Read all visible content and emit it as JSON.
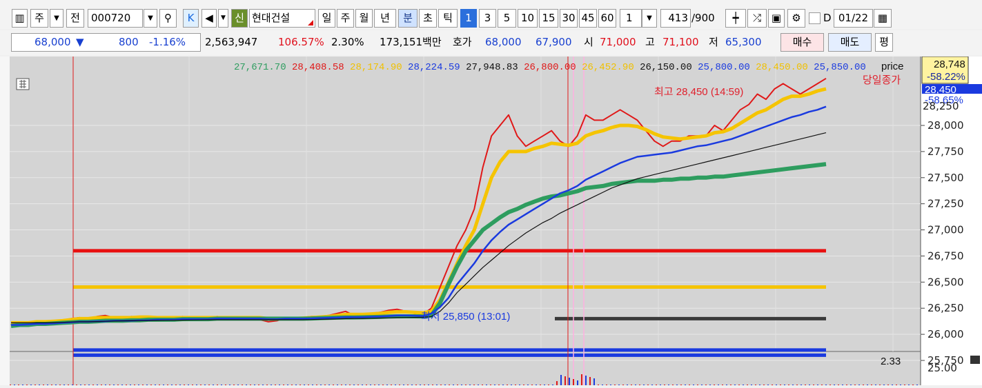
{
  "toolbar": {
    "market_btn": "주",
    "prev_btn": "전",
    "code": "000720",
    "k_btn": "K",
    "credit_badge": "신",
    "name": "현대건설",
    "periods": [
      "일",
      "주",
      "월",
      "년",
      "분",
      "초",
      "틱"
    ],
    "selected_period": "분",
    "minutes": [
      "1",
      "3",
      "5",
      "10",
      "15",
      "30",
      "45",
      "60"
    ],
    "selected_minute": "1",
    "multiplier": "1",
    "count": "413",
    "count_total": "/900",
    "date_label": "D",
    "date_value": "01/22"
  },
  "quote": {
    "price": "68,000",
    "change_arrow": "▼",
    "change": "800",
    "change_pct": "-1.16%",
    "volume": "2,563,947",
    "vol_ratio": "106.57%",
    "turnover": "2.30%",
    "amount": "173,151백만",
    "hoga_label": "호가",
    "ask": "68,000",
    "bid": "67,900",
    "open_label": "시",
    "open": "71,000",
    "high_label": "고",
    "high": "71,100",
    "low_label": "저",
    "low": "65,300",
    "buy_btn": "매수",
    "sell_btn": "매도",
    "eval_btn": "평"
  },
  "chart_data": {
    "type": "line",
    "legend_values": [
      {
        "text": "27,671.70",
        "color": "#2e9d5f"
      },
      {
        "text": "28,408.58",
        "color": "#e01818"
      },
      {
        "text": "28,174.90",
        "color": "#f0c000"
      },
      {
        "text": "28,224.59",
        "color": "#1a3adf"
      },
      {
        "text": "27,948.83",
        "color": "#111111"
      },
      {
        "text": "26,800.00",
        "color": "#e01818"
      },
      {
        "text": "26,452.90",
        "color": "#f0c000"
      },
      {
        "text": "26,150.00",
        "color": "#111111"
      },
      {
        "text": "25,800.00",
        "color": "#1a3adf"
      },
      {
        "text": "28,450.00",
        "color": "#f0c000"
      },
      {
        "text": "25,850.00",
        "color": "#1a3adf"
      }
    ],
    "legend_price": "price",
    "ylim": [
      25600,
      28850
    ],
    "yticks": [
      28000,
      27750,
      27500,
      27250,
      27000,
      26750,
      26500,
      26250,
      26000,
      25750
    ],
    "ytick_labels": [
      "28,000",
      "27,750",
      "27,500",
      "27,250",
      "27,000",
      "26,750",
      "26,500",
      "26,250",
      "26,000",
      "25,750"
    ],
    "partial_tick_label": "28,250",
    "price_box": {
      "value": "28,748",
      "pct": "-58.22%"
    },
    "last_box": {
      "value": "28,450",
      "pct": "-58.65%"
    },
    "prev_close_label": "당일종가",
    "high_annotation": "최고 28,450 (14:59)",
    "low_annotation": "최저 25,850 (13:01)",
    "levels": [
      {
        "value": 26800,
        "color": "#e81010"
      },
      {
        "value": 26452.9,
        "color": "#f5c400"
      },
      {
        "value": 26150,
        "color": "#3a3a3a"
      },
      {
        "value": 25850,
        "color": "#1a3adf"
      },
      {
        "value": 25800,
        "color": "#1a3adf"
      },
      {
        "value": 28749,
        "color": "#e0202c"
      }
    ],
    "lower_pane": {
      "indicator_value": "2.33",
      "axis_label": "25.00"
    },
    "series": [
      {
        "color": "#e01818",
        "values": [
          26090,
          26100,
          26090,
          26120,
          26100,
          26110,
          26130,
          26150,
          26160,
          26140,
          26170,
          26180,
          26160,
          26150,
          26170,
          26160,
          26170,
          26150,
          26150,
          26140,
          26170,
          26150,
          26150,
          26140,
          26170,
          26160,
          26160,
          26160,
          26150,
          26140,
          26120,
          26130,
          26160,
          26150,
          26160,
          26170,
          26170,
          26180,
          26200,
          26220,
          26180,
          26180,
          26200,
          26210,
          26230,
          26240,
          26220,
          26200,
          26190,
          26250,
          26450,
          26650,
          26850,
          27000,
          27200,
          27600,
          27900,
          28000,
          28100,
          27900,
          27800,
          27850,
          27900,
          27950,
          27850,
          27800,
          27900,
          28100,
          28050,
          28050,
          28100,
          28150,
          28100,
          28050,
          27950,
          27850,
          27800,
          27850,
          27850,
          27900,
          27900,
          27900,
          28000,
          27950,
          28050,
          28150,
          28200,
          28300,
          28250,
          28350,
          28400,
          28350,
          28300,
          28350,
          28400,
          28450
        ]
      },
      {
        "color": "#f5c400",
        "values": [
          26110,
          26110,
          26110,
          26120,
          26120,
          26125,
          26130,
          26140,
          26150,
          26150,
          26160,
          26160,
          26160,
          26160,
          26160,
          26165,
          26165,
          26160,
          26160,
          26160,
          26160,
          26160,
          26160,
          26160,
          26160,
          26160,
          26160,
          26160,
          26160,
          26160,
          26150,
          26150,
          26150,
          26150,
          26155,
          26160,
          26165,
          26170,
          26180,
          26190,
          26190,
          26190,
          26195,
          26200,
          26210,
          26215,
          26215,
          26210,
          26205,
          26220,
          26330,
          26500,
          26680,
          26850,
          27000,
          27250,
          27500,
          27650,
          27750,
          27750,
          27750,
          27780,
          27800,
          27830,
          27820,
          27810,
          27830,
          27900,
          27930,
          27950,
          27980,
          28000,
          28000,
          27990,
          27960,
          27920,
          27890,
          27880,
          27870,
          27880,
          27890,
          27900,
          27930,
          27940,
          27970,
          28020,
          28070,
          28120,
          28150,
          28200,
          28250,
          28280,
          28280,
          28300,
          28330,
          28350
        ]
      },
      {
        "color": "#2e9d5f",
        "values": [
          26080,
          26090,
          26090,
          26100,
          26100,
          26105,
          26110,
          26115,
          26120,
          26120,
          26125,
          26130,
          26130,
          26130,
          26135,
          26135,
          26140,
          26140,
          26140,
          26140,
          26145,
          26145,
          26145,
          26145,
          26150,
          26150,
          26150,
          26150,
          26150,
          26150,
          26150,
          26150,
          26150,
          26150,
          26150,
          26152,
          26155,
          26157,
          26160,
          26162,
          26162,
          26163,
          26165,
          26167,
          26170,
          26172,
          26172,
          26172,
          26171,
          26180,
          26300,
          26480,
          26650,
          26800,
          26900,
          27000,
          27060,
          27120,
          27170,
          27200,
          27240,
          27270,
          27300,
          27320,
          27330,
          27350,
          27370,
          27400,
          27410,
          27420,
          27440,
          27450,
          27460,
          27470,
          27470,
          27470,
          27480,
          27480,
          27490,
          27490,
          27500,
          27500,
          27510,
          27510,
          27520,
          27530,
          27540,
          27550,
          27560,
          27570,
          27580,
          27590,
          27600,
          27610,
          27620,
          27630
        ]
      },
      {
        "color": "#1a3adf",
        "values": [
          26090,
          26090,
          26095,
          26100,
          26100,
          26105,
          26110,
          26115,
          26120,
          26120,
          26125,
          26125,
          26130,
          26130,
          26130,
          26135,
          26135,
          26140,
          26140,
          26140,
          26145,
          26145,
          26145,
          26145,
          26150,
          26150,
          26150,
          26150,
          26150,
          26150,
          26145,
          26145,
          26150,
          26150,
          26150,
          26152,
          26155,
          26157,
          26160,
          26165,
          26165,
          26165,
          26168,
          26170,
          26175,
          26180,
          26180,
          26178,
          26175,
          26200,
          26260,
          26350,
          26480,
          26580,
          26680,
          26800,
          26900,
          26980,
          27050,
          27100,
          27150,
          27200,
          27250,
          27300,
          27350,
          27380,
          27420,
          27480,
          27520,
          27560,
          27600,
          27640,
          27670,
          27700,
          27710,
          27720,
          27730,
          27740,
          27760,
          27780,
          27800,
          27810,
          27830,
          27850,
          27870,
          27900,
          27930,
          27960,
          27990,
          28020,
          28050,
          28080,
          28100,
          28130,
          28150,
          28180
        ]
      },
      {
        "color": "#111111",
        "values": [
          26110,
          26110,
          26110,
          26110,
          26110,
          26112,
          26115,
          26118,
          26120,
          26120,
          26122,
          26125,
          26127,
          26129,
          26130,
          26131,
          26132,
          26133,
          26134,
          26135,
          26136,
          26137,
          26138,
          26139,
          26140,
          26140,
          26140,
          26140,
          26140,
          26140,
          26140,
          26140,
          26140,
          26140,
          26140,
          26141,
          26143,
          26145,
          26147,
          26150,
          26151,
          26152,
          26154,
          26156,
          26158,
          26160,
          26161,
          26162,
          26163,
          26170,
          26220,
          26300,
          26400,
          26480,
          26560,
          26640,
          26710,
          26780,
          26850,
          26910,
          26970,
          27020,
          27070,
          27110,
          27160,
          27200,
          27240,
          27280,
          27320,
          27360,
          27400,
          27430,
          27460,
          27490,
          27510,
          27530,
          27550,
          27570,
          27590,
          27610,
          27630,
          27650,
          27670,
          27690,
          27710,
          27730,
          27750,
          27770,
          27790,
          27810,
          27830,
          27850,
          27870,
          27890,
          27910,
          27930
        ]
      }
    ]
  }
}
